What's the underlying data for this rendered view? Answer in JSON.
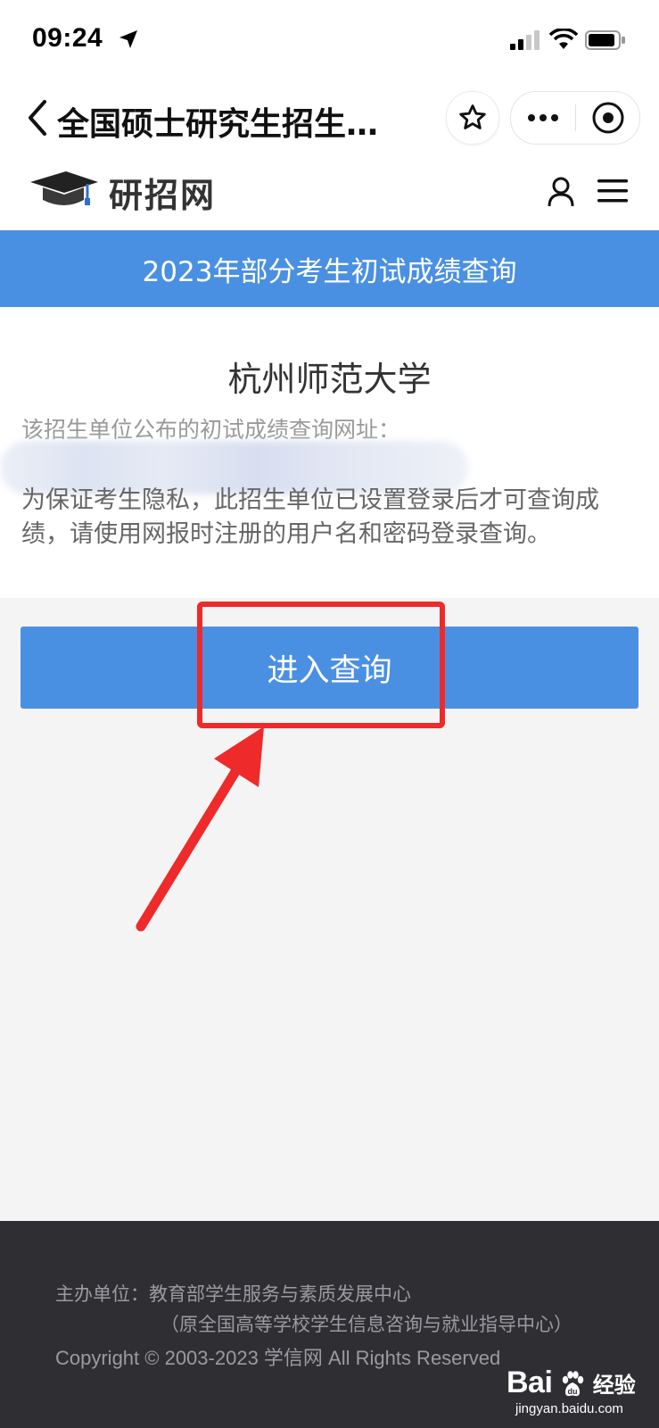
{
  "status_bar": {
    "time": "09:24"
  },
  "nav": {
    "title": "全国硕士研究生招生…"
  },
  "site": {
    "logo_text": "研招网"
  },
  "banner": {
    "title": "2023年部分考生初试成绩查询"
  },
  "content": {
    "university": "杭州师范大学",
    "url_label": "该招生单位公布的初试成绩查询网址：",
    "notice": "为保证考生隐私，此招生单位已设置登录后才可查询成绩，请使用网报时注册的用户名和密码登录查询。"
  },
  "query_button": {
    "label": "进入查询"
  },
  "footer": {
    "host": "主办单位：教育部学生服务与素质发展中心",
    "host_note": "（原全国高等学校学生信息咨询与就业指导中心）",
    "copyright": "Copyright © 2003-2023 学信网 All Rights Reserved"
  },
  "watermark": {
    "brand": "Bai",
    "brand_suffix": "经验",
    "url": "jingyan.baidu.com"
  },
  "colors": {
    "primary": "#4a90e2",
    "highlight": "#ee2a2a",
    "footer_bg": "#2f2f33"
  }
}
